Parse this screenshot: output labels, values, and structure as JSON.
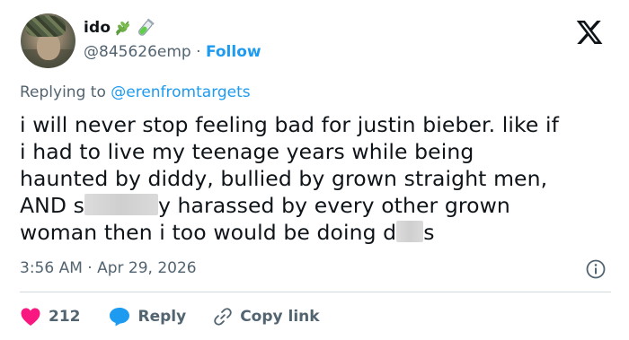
{
  "user": {
    "display_name": "ido",
    "handle": "@845626emp",
    "separator": "·",
    "follow_label": "Follow"
  },
  "reply": {
    "prefix": "Replying to",
    "mention": "@erenfromtargets"
  },
  "tweet": {
    "line1": "i will never stop feeling bad for justin bieber. like if",
    "line2": "i had to live my teenage years while being",
    "line3": "haunted by diddy, bullied by grown straight men,",
    "line4a": "AND s",
    "line4b": "y harassed by every other grown",
    "line5a": "woman then i too would be doing d",
    "line5b": "s"
  },
  "meta": {
    "time": "3:56 AM",
    "separator": "·",
    "date": "Apr 29, 2026"
  },
  "actions": {
    "likes": "212",
    "reply_label": "Reply",
    "copy_label": "Copy link"
  },
  "colors": {
    "accent": "#1d9bf0",
    "like": "#f91880",
    "text": "#0f1419",
    "secondary": "#536471"
  },
  "icons": {
    "platform": "x-logo-icon",
    "name_emoji_1": "herb-icon",
    "name_emoji_2": "test-tube-icon"
  }
}
